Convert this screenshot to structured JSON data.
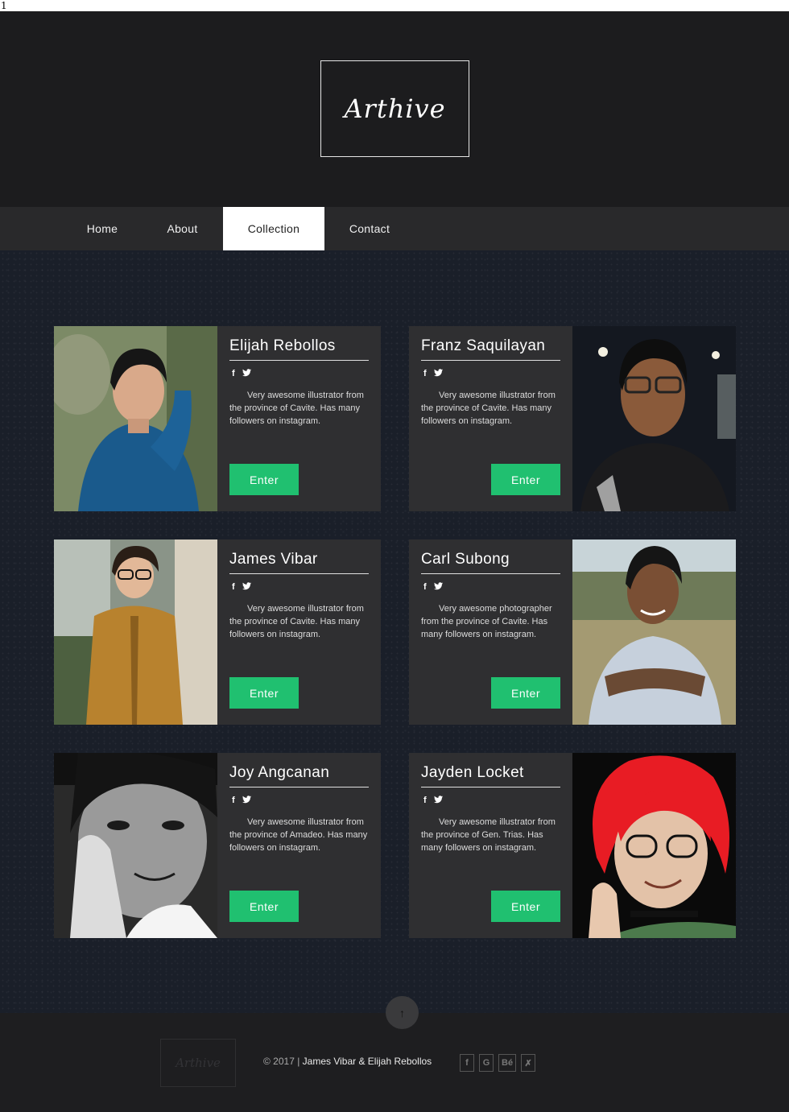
{
  "top_strip": {
    "text": "1"
  },
  "brand": {
    "logo_text": "Arthive",
    "accent": "#20c070"
  },
  "nav": {
    "items": [
      {
        "label": "Home"
      },
      {
        "label": "About"
      },
      {
        "label": "Collection",
        "active": true
      },
      {
        "label": "Contact"
      }
    ]
  },
  "artists": [
    {
      "name": "Elijah Rebollos",
      "description": "Very awesome illustrator from the province of Cavite. Has many followers on instagram.",
      "button": "Enter",
      "facebook_icon": "f",
      "twitter_icon": "•"
    },
    {
      "name": "Franz Saquilayan",
      "description": "Very awesome illustrator from the province of Cavite. Has many followers on instagram.",
      "button": "Enter",
      "facebook_icon": "f",
      "twitter_icon": "•"
    },
    {
      "name": "James Vibar",
      "description": "Very awesome illustrator from the province of Cavite. Has many followers on instagram.",
      "button": "Enter",
      "facebook_icon": "f",
      "twitter_icon": "•"
    },
    {
      "name": "Carl Subong",
      "description": "Very awesome photographer from the province of Cavite. Has many followers on instagram.",
      "button": "Enter",
      "facebook_icon": "f",
      "twitter_icon": "•"
    },
    {
      "name": "Joy Angcanan",
      "description": "Very awesome illustrator from the province of Amadeo. Has many followers on instagram.",
      "button": "Enter",
      "facebook_icon": "f",
      "twitter_icon": "•"
    },
    {
      "name": "Jayden Locket",
      "description": "Very awesome illustrator from the province of Gen. Trias. Has many followers on instagram.",
      "button": "Enter",
      "facebook_icon": "f",
      "twitter_icon": "•"
    }
  ],
  "footer": {
    "logo_text": "Arthive",
    "copyright_prefix": "© 2017 | ",
    "copyright_names": "James Vibar & Elijah Rebollos",
    "up_icon": "↑",
    "social_icons": [
      {
        "name": "facebook-square-icon",
        "glyph": "f"
      },
      {
        "name": "google-icon",
        "glyph": "G"
      },
      {
        "name": "behance-icon",
        "glyph": "Bé"
      },
      {
        "name": "deviantart-icon",
        "glyph": "✗"
      }
    ]
  }
}
